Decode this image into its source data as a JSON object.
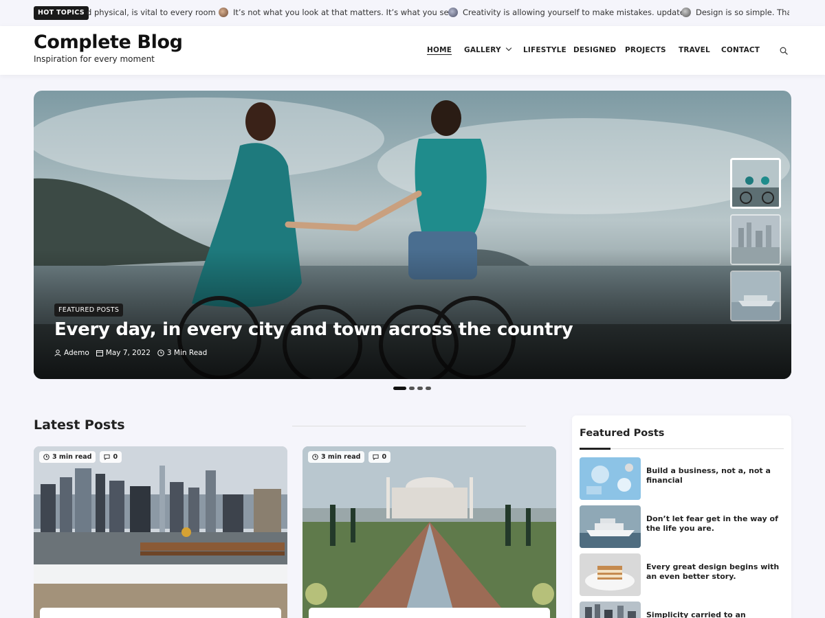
{
  "ticker": {
    "label": "HOT TOPICS",
    "items": [
      {
        "text": "d physical, is vital to every room",
        "thumb": ""
      },
      {
        "text": "It’s not what you look at that matters. It’s what you see.",
        "thumb": "#8a6a55"
      },
      {
        "text": "Creativity is allowing yourself to make mistakes. update",
        "thumb": "#6b6f86"
      },
      {
        "text": "Design is so simple. That’s",
        "thumb": "#7a7a7a"
      }
    ]
  },
  "header": {
    "site_title": "Complete Blog",
    "tagline": "Inspiration for every moment",
    "nav": [
      {
        "label": "HOME",
        "active": true
      },
      {
        "label": "GALLERY",
        "dropdown": true
      },
      {
        "label": "LIFESTYLE"
      },
      {
        "label": "DESIGNED"
      },
      {
        "label": "PROJECTS"
      },
      {
        "label": "TRAVEL"
      },
      {
        "label": "CONTACT"
      }
    ],
    "search_icon": "search-icon"
  },
  "hero": {
    "category": "FEATURED POSTS",
    "title": "Every day, in every city and town across the country",
    "author": "Ademo",
    "date": "May 7, 2022",
    "read_time": "3 Min Read",
    "slides_total": 4,
    "slide_active": 1
  },
  "latest": {
    "title": "Latest Posts",
    "cards": [
      {
        "read_time": "3 min read",
        "comments": "0"
      },
      {
        "read_time": "3 min read",
        "comments": "0"
      }
    ]
  },
  "sidebar": {
    "title": "Featured Posts",
    "posts": [
      {
        "title": "Build a business, not a, not a financial"
      },
      {
        "title": "Don’t let fear get in the way of the life you are."
      },
      {
        "title": "Every great design begins with an even better story."
      },
      {
        "title": "Simplicity carried to an extreme"
      }
    ]
  }
}
